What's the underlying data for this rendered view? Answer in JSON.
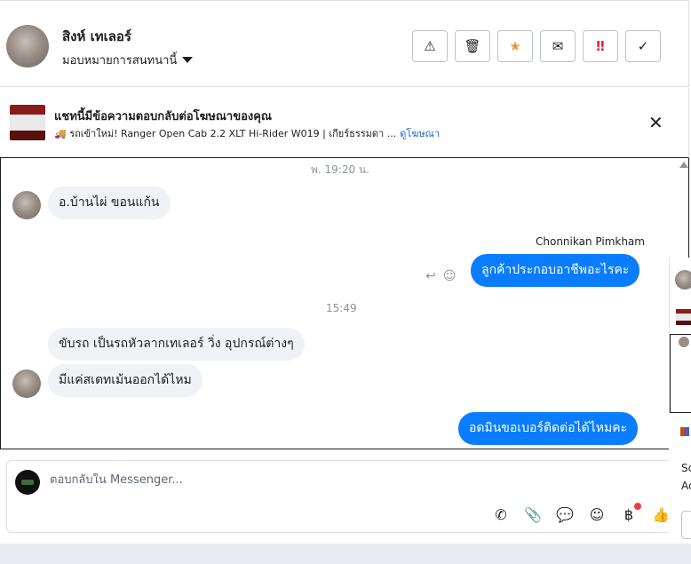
{
  "header": {
    "contact_name": "สิงห์ เทเลอร์",
    "assign_label": "มอบหมายการสนทนานี้",
    "actions": [
      {
        "icon": "warning-icon",
        "glyph": "⚠"
      },
      {
        "icon": "trash-icon",
        "glyph": "🗑"
      },
      {
        "icon": "star-icon",
        "glyph": "★"
      },
      {
        "icon": "open-envelope-icon",
        "glyph": "✉"
      },
      {
        "icon": "urgent-icon",
        "glyph": "‼"
      },
      {
        "icon": "check-icon",
        "glyph": "✓"
      }
    ]
  },
  "ad_banner": {
    "title": "แชทนี้มีข้อความตอบกลับต่อโฆษณาของคุณ",
    "ad_text": "🚚 รถเข้าใหม่! Ranger Open Cab 2.2 XLT Hi-Rider W019 | เกียร์ธรรมดา ...",
    "link": "ดูโฆษณา",
    "close_glyph": "✕"
  },
  "messages": {
    "timestamp_1": "พ. 19:20 น.",
    "in_1": "อ.บ้านไผ่  ขอนแก้น",
    "sender_out": "Chonnikan Pimkham",
    "out_1": "ลูกค้าประกอบอาชีพอะไรคะ",
    "reply_glyph": "↩",
    "emoji_glyph": "☺",
    "timestamp_2": "15:49",
    "in_2": "ขับรถ เป็นรถหัวลากเทเลอร์ วิ่ง อุปกรณ์ต่างๆ",
    "in_3": "มีแค่สเตทเม้นออกได้ไหม",
    "out_2": "อดมินขอเบอร์ติดต่อได้ไหมคะ"
  },
  "composer": {
    "placeholder": "ตอบกลับใน Messenger...",
    "tools": [
      {
        "icon": "phone-icon",
        "glyph": "✆"
      },
      {
        "icon": "attachment-icon",
        "glyph": "📎"
      },
      {
        "icon": "saved-reply-icon",
        "glyph": "💬"
      },
      {
        "icon": "emoji-icon",
        "glyph": "☺"
      },
      {
        "icon": "baht-payment-icon",
        "glyph": "฿"
      },
      {
        "icon": "thumbs-up-icon",
        "glyph": "👍"
      }
    ]
  },
  "side_panel": {
    "text_line_1": "Sc",
    "text_line_2": "Ac"
  }
}
